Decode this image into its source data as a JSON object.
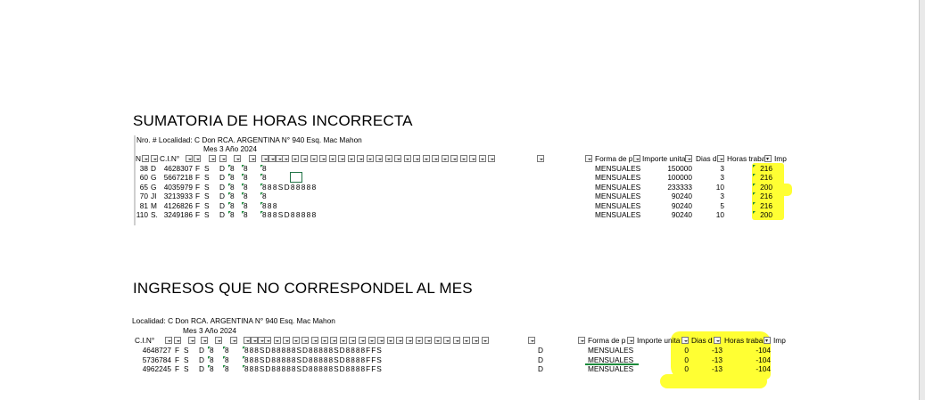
{
  "headings": {
    "section1": "SUMATORIA DE HORAS INCORRECTA",
    "section2": "INGRESOS QUE NO CORRESPONDEL AL MES"
  },
  "table1": {
    "info_line": "Nro. # Localidad:  C Don RCA. ARGENTINA N° 940 Esq. Mac Mahon",
    "mes_line": "Mes   3  Año  2024",
    "headers": {
      "n": "N",
      "ci": "C.I.N°",
      "forma": "Forma de p",
      "importe": "Importe unita",
      "dias": "Dias d",
      "horas": "Horas traba",
      "imp": "Imp"
    },
    "rows": [
      {
        "nro": "38",
        "ini": "D",
        "ci": "4628307",
        "a": "F",
        "b": "S",
        "c": "D",
        "d1": "8",
        "d2": "8",
        "days": "8",
        "forma": "MENSUALES",
        "importe": "150000",
        "dias": "3",
        "horas": "216"
      },
      {
        "nro": "60",
        "ini": "G",
        "ci": "5667218",
        "a": "F",
        "b": "S",
        "c": "D",
        "d1": "8",
        "d2": "8",
        "days": "8",
        "forma": "MENSUALES",
        "importe": "100000",
        "dias": "3",
        "horas": "216"
      },
      {
        "nro": "65",
        "ini": "G",
        "ci": "4035979",
        "a": "F",
        "b": "S",
        "c": "D",
        "d1": "8",
        "d2": "8",
        "days": "8  8  8  S  D  8  8  8  8  8",
        "forma": "MENSUALES",
        "importe": "233333",
        "dias": "10",
        "horas": "200"
      },
      {
        "nro": "70",
        "ini": "JI",
        "ci": "3213933",
        "a": "F",
        "b": "S",
        "c": "D",
        "d1": "8",
        "d2": "8",
        "days": "8",
        "forma": "MENSUALES",
        "importe": "90240",
        "dias": "3",
        "horas": "216"
      },
      {
        "nro": "81",
        "ini": "M",
        "ci": "4126826",
        "a": "F",
        "b": "S",
        "c": "D",
        "d1": "8",
        "d2": "8",
        "days": "8  8  8",
        "forma": "MENSUALES",
        "importe": "90240",
        "dias": "5",
        "horas": "216"
      },
      {
        "nro": "110",
        "ini": "S.",
        "ci": "3249186",
        "a": "F",
        "b": "S",
        "c": "D",
        "d1": "8",
        "d2": "8",
        "days": "8  8  8  S  D  8  8  8  8  8",
        "forma": "MENSUALES",
        "importe": "90240",
        "dias": "10",
        "horas": "200"
      }
    ]
  },
  "table2": {
    "info_line": "Localidad:  C Don RCA. ARGENTINA N° 940 Esq. Mac Mahon",
    "mes_line": "Mes   3  Año  2024",
    "headers": {
      "ci": "C.I.N°",
      "forma": "Forma de p",
      "importe": "Importe unita",
      "dias": "Dias d",
      "horas": "Horas traba",
      "imp": "Imp"
    },
    "rows": [
      {
        "ci": "4648727",
        "a": "F",
        "b": "S",
        "c": "D",
        "d1": "8",
        "d2": "8",
        "days": "8  8  8  S  D  8  8  8  8  8  S  D  8  8  8  8  8  S  D  8  8  8  8  F  F  S",
        "end": "D",
        "forma": "MENSUALES",
        "importe": "0",
        "dias": "-13",
        "horas": "-104"
      },
      {
        "ci": "5736784",
        "a": "F",
        "b": "S",
        "c": "D",
        "d1": "8",
        "d2": "8",
        "days": "8  8  8  S  D  8  8  8  8  8  S  D  8  8  8  8  8  S  D  8  8  8  8  F  F  S",
        "end": "D",
        "forma": "MENSUALES",
        "importe": "0",
        "dias": "-13",
        "horas": "-104"
      },
      {
        "ci": "4962245",
        "a": "F",
        "b": "S",
        "c": "D",
        "d1": "8",
        "d2": "8",
        "days": "8  8  8  S  D  8  8  8  8  8  S  D  8  8  8  8  8  S  D  8  8  8  8  F  F  S",
        "end": "D",
        "forma": "MENSUALES",
        "importe": "0",
        "dias": "-13",
        "horas": "-104"
      }
    ]
  },
  "colors": {
    "highlight": "#ffff33",
    "cell_marker": "#1a8a3a",
    "selection": "#217346"
  }
}
